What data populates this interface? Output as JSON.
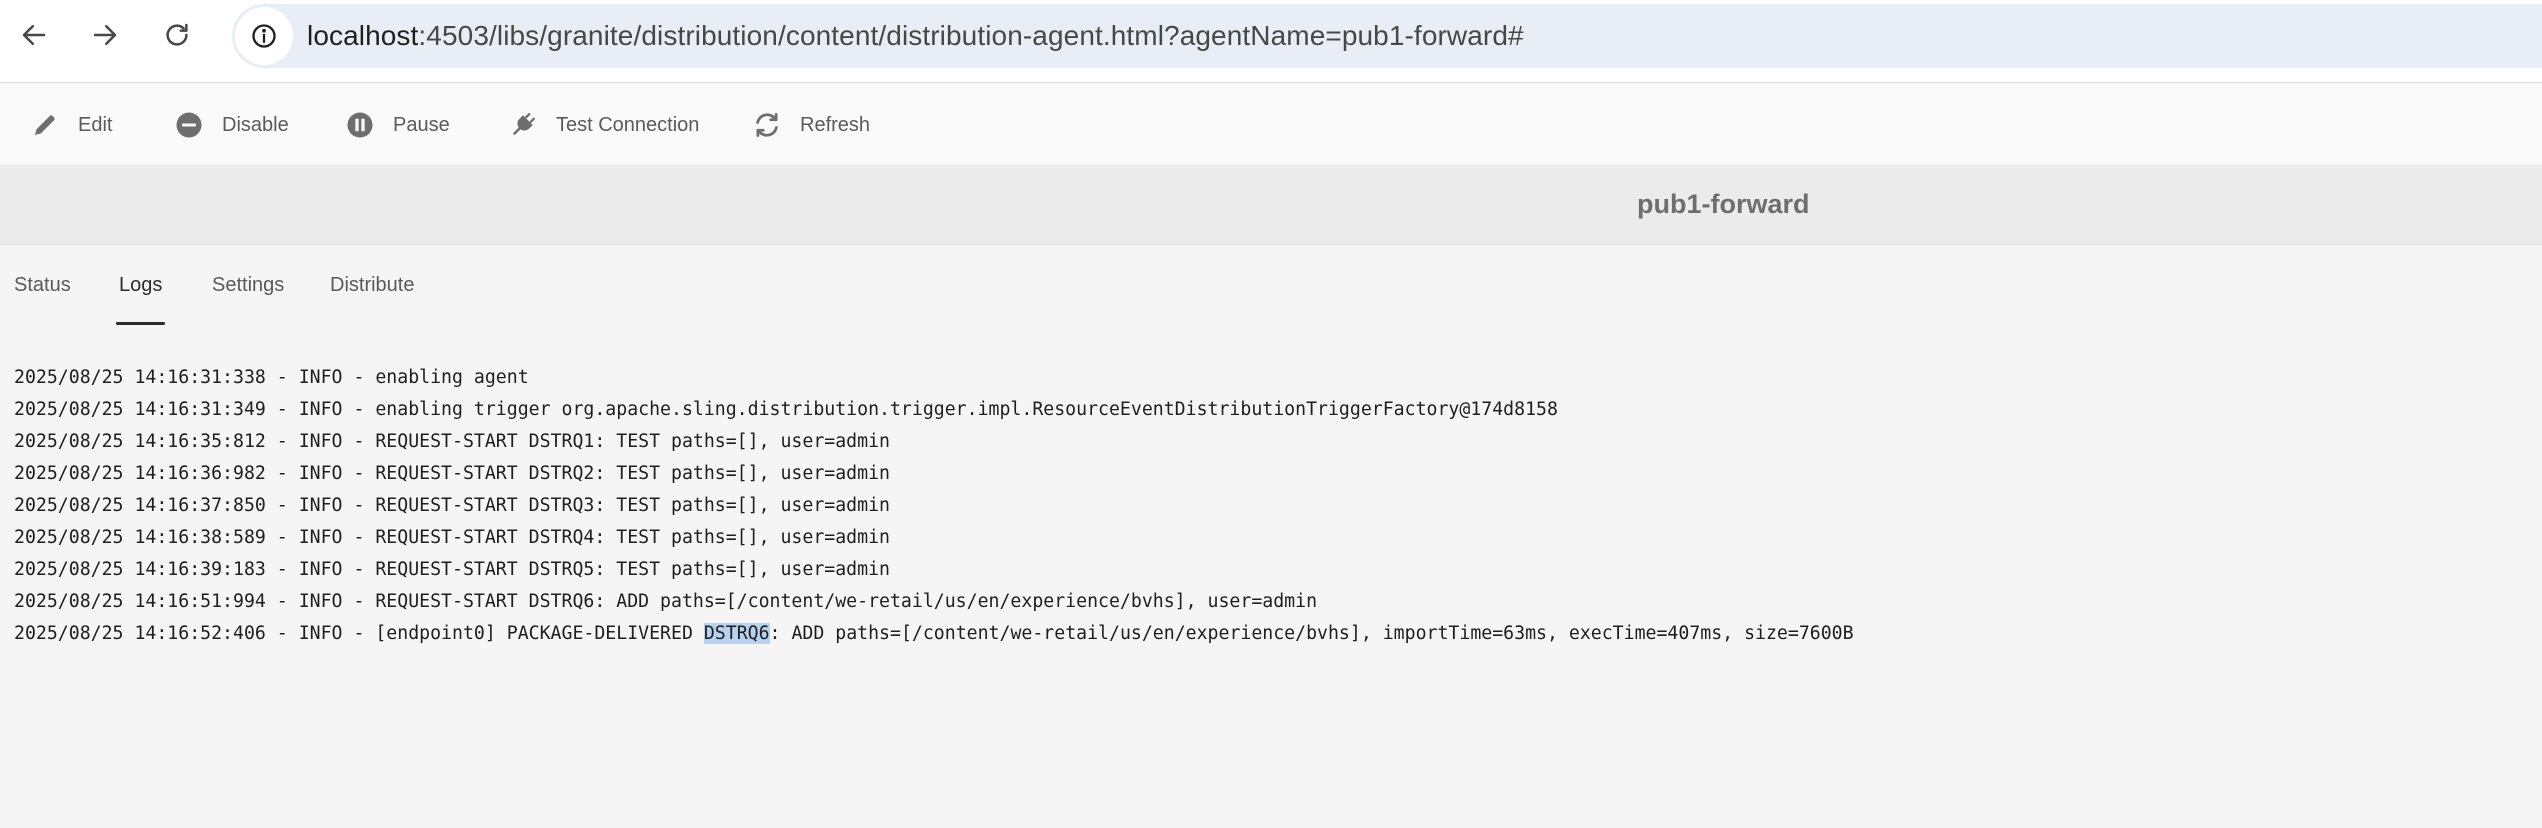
{
  "browser": {
    "url_host": "localhost",
    "url_rest": ":4503/libs/granite/distribution/content/distribution-agent.html?agentName=pub1-forward#"
  },
  "toolbar": {
    "edit_label": "Edit",
    "disable_label": "Disable",
    "pause_label": "Pause",
    "test_connection_label": "Test Connection",
    "refresh_label": "Refresh"
  },
  "header": {
    "title": "pub1-forward"
  },
  "tabs": [
    {
      "label": "Status",
      "active": false
    },
    {
      "label": "Logs",
      "active": true
    },
    {
      "label": "Settings",
      "active": false
    },
    {
      "label": "Distribute",
      "active": false
    }
  ],
  "logs": [
    {
      "text": "2025/08/25 14:16:31:338 - INFO - enabling agent"
    },
    {
      "text": "2025/08/25 14:16:31:349 - INFO - enabling trigger org.apache.sling.distribution.trigger.impl.ResourceEventDistributionTriggerFactory@174d8158"
    },
    {
      "text": "2025/08/25 14:16:35:812 - INFO - REQUEST-START DSTRQ1: TEST paths=[], user=admin"
    },
    {
      "text": "2025/08/25 14:16:36:982 - INFO - REQUEST-START DSTRQ2: TEST paths=[], user=admin"
    },
    {
      "text": "2025/08/25 14:16:37:850 - INFO - REQUEST-START DSTRQ3: TEST paths=[], user=admin"
    },
    {
      "text": "2025/08/25 14:16:38:589 - INFO - REQUEST-START DSTRQ4: TEST paths=[], user=admin"
    },
    {
      "text": "2025/08/25 14:16:39:183 - INFO - REQUEST-START DSTRQ5: TEST paths=[], user=admin"
    },
    {
      "text": "2025/08/25 14:16:51:994 - INFO - REQUEST-START DSTRQ6: ADD paths=[/content/we-retail/us/en/experience/bvhs], user=admin"
    },
    {
      "before": "2025/08/25 14:16:52:406 - INFO - [endpoint0] PACKAGE-DELIVERED ",
      "highlight": "DSTRQ6",
      "after": ": ADD paths=[/content/we-retail/us/en/experience/bvhs], importTime=63ms, execTime=407ms, size=7600B"
    }
  ],
  "colors": {
    "address_bar": "#e9eef6",
    "selection_highlight": "#b7d1ee",
    "active_tab_underline": "#2c2c2c"
  },
  "icons": {
    "back": "arrow-left-icon",
    "forward": "arrow-right-icon",
    "reload": "reload-icon",
    "site_info": "info-circle-icon",
    "edit": "pencil-icon",
    "disable": "minus-circle-icon",
    "pause": "pause-circle-icon",
    "test_connection": "plug-icon",
    "refresh": "refresh-icon"
  }
}
